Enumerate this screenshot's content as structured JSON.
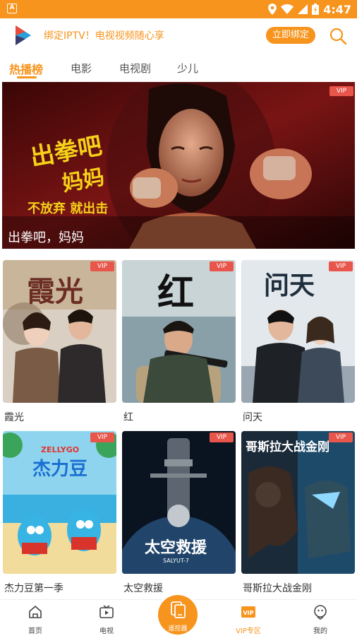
{
  "status_bar": {
    "time": "4:47",
    "notif_letter": "A"
  },
  "header": {
    "slogan": "绑定IPTV！电视视频随心享",
    "bind_button": "立即绑定",
    "accent_color": "#f7941d"
  },
  "tabs": [
    {
      "label": "热播榜",
      "active": true
    },
    {
      "label": "电影",
      "active": false
    },
    {
      "label": "电视剧",
      "active": false
    },
    {
      "label": "少儿",
      "active": false
    }
  ],
  "banner": {
    "caption": "出拳吧，妈妈",
    "vip": "VIP",
    "art_title_line1": "出拳吧",
    "art_title_line2": "妈妈",
    "art_tagline": "不放弃 就出击"
  },
  "cards": [
    {
      "title": "霞光",
      "vip": "VIP",
      "poster_text": "霞光"
    },
    {
      "title": "红",
      "vip": "VIP",
      "poster_text": "红"
    },
    {
      "title": "问天",
      "vip": "VIP",
      "poster_text": "问天"
    },
    {
      "title": "杰力豆第一季",
      "vip": "VIP",
      "poster_text": "杰力豆",
      "poster_brand": "ZELLYGO"
    },
    {
      "title": "太空救援",
      "vip": "VIP",
      "poster_text": "太空救援",
      "poster_sub": "SALYUT-7"
    },
    {
      "title": "哥斯拉大战金刚",
      "vip": "VIP",
      "poster_text": "哥斯拉大战金刚"
    }
  ],
  "bottom_nav": {
    "home": "首页",
    "tv": "电视",
    "remote": "遥控器",
    "vip": "VIP专区",
    "vip_icon_text": "VIP",
    "mine": "我的"
  }
}
